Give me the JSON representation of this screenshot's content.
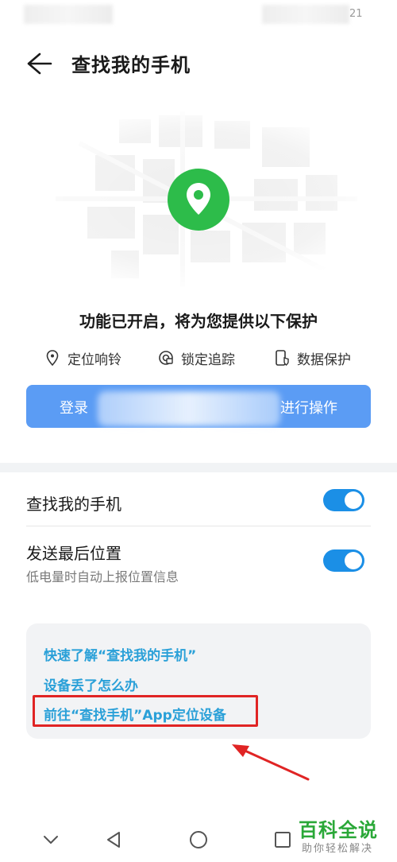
{
  "status_bar": {
    "time_fragment": "21"
  },
  "header": {
    "title": "查找我的手机",
    "back_icon": "arrow-left-icon"
  },
  "hero": {
    "pin_icon": "location-pin-icon",
    "pin_color": "#2dbc4a",
    "title": "功能已开启，将为您提供以下保护"
  },
  "features": [
    {
      "icon": "location-outline-icon",
      "label": "定位响铃"
    },
    {
      "icon": "lock-track-icon",
      "label": "锁定追踪"
    },
    {
      "icon": "phone-shield-icon",
      "label": "数据保护"
    }
  ],
  "login": {
    "prefix": "登录",
    "suffix": "进行操作",
    "color": "#5b9cf4"
  },
  "settings": [
    {
      "label": "查找我的手机",
      "enabled": true
    },
    {
      "label": "发送最后位置",
      "description": "低电量时自动上报位置信息",
      "enabled": true
    }
  ],
  "toggle_color": "#1b8fe6",
  "help_links": [
    "快速了解“查找我的手机”",
    "设备丢了怎么办",
    "前往“查找手机”App定位设备"
  ],
  "link_color": "#2aa0d8",
  "highlight_color": "#e02424",
  "nav": [
    "chevron-down-icon",
    "triangle-back-icon",
    "circle-home-icon",
    "square-recent-icon"
  ],
  "watermark": {
    "main": "百科全说",
    "sub": "助你轻松解决"
  }
}
